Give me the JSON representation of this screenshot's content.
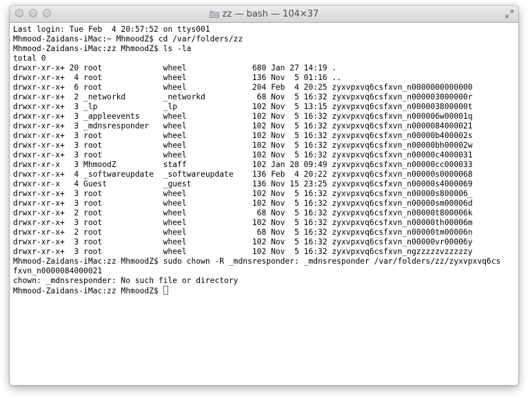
{
  "window": {
    "title": "zz — bash — 104×37",
    "folder_icon": "folder-icon",
    "controls": [
      "close-button",
      "minimize-button",
      "zoom-button"
    ],
    "resize_icon": "fullscreen-arrows-icon"
  },
  "terminal": {
    "lines": [
      "Last login: Tue Feb  4 20:57:52 on ttys001",
      "Mhmood-Zaidans-iMac:~ MhmoodZ$ cd /var/folders/zz",
      "Mhmood-Zaidans-iMac:zz MhmoodZ$ ls -la",
      "total 0",
      "drwxr-xr-x+ 20 root             wheel              680 Jan 27 14:19 .",
      "drwxr-xr-x+  4 root             wheel              136 Nov  5 01:16 ..",
      "drwxr-xr-x+  6 root             wheel              204 Feb  4 20:25 zyxvpxvq6csfxvn_n0000000000000",
      "drwxr-xr-x+  2 _networkd        _networkd           68 Nov  5 16:32 zyxvpxvq6csfxvn_n000003000000r",
      "drwxr-xr-x+  3 _lp              _lp                102 Nov  5 13:15 zyxvpxvq6csfxvn_n000003800000t",
      "drwxr-xr-x+  3 _appleevents     wheel              102 Nov  5 16:32 zyxvpxvq6csfxvn_n000006w00001q",
      "drwxr-xr-x+  3 _mdnsresponder   wheel              102 Nov  5 16:32 zyxvpxvq6csfxvn_n0000084000021",
      "drwxr-xr-x+  3 root             wheel              102 Nov  5 16:32 zyxvpxvq6csfxvn_n00000b400002s",
      "drwxr-xr-x+  3 root             wheel              102 Nov  5 16:32 zyxvpxvq6csfxvn_n00000bh00002w",
      "drwxr-xr-x+  3 root             wheel              102 Nov  5 16:32 zyxvpxvq6csfxvn_n00000c4000031",
      "drwxr-xr-x   3 MhmoodZ          staff              102 Jan 28 09:49 zyxvpxvq6csfxvn_n00000cc000033",
      "drwxr-xr-x+  4 _softwareupdate  _softwareupdate    136 Feb  4 20:22 zyxvpxvq6csfxvn_n00000s0000068",
      "drwxr-xr-x   4 Guest            _guest             136 Nov 15 23:25 zyxvpxvq6csfxvn_n00000s4000069",
      "drwxr-xr-x+  3 root             wheel              102 Nov  5 16:32 zyxvpxvq6csfxvn_n00000s800006_",
      "drwxr-xr-x+  3 root             wheel              102 Nov  5 16:32 zyxvpxvq6csfxvn_n00000sm00006d",
      "drwxr-xr-x+  2 root             wheel               68 Nov  5 16:32 zyxvpxvq6csfxvn_n00000t800006k",
      "drwxr-xr-x+  3 root             wheel              102 Nov  5 16:32 zyxvpxvq6csfxvn_n00000th00006m",
      "drwxr-xr-x+  2 root             wheel               68 Nov  5 16:32 zyxvpxvq6csfxvn_n00000tm00006n",
      "drwxr-xr-x+  3 root             wheel              102 Nov  5 16:32 zyxvpxvq6csfxvn_n00000vr00006y",
      "drwxr-xr-x+  3 root             wheel              102 Nov  5 16:32 zyxvpxvq6csfxvn_ngzzzzzvzzzzzy",
      "Mhmood-Zaidans-iMac:zz MhmoodZ$ sudo chown -R _mdnsresponder: _mdnsresponder /var/folders/zz/zyxvpxvq6cs",
      "fxvn_n0000084000021",
      "chown: _mdnsresponder: No such file or directory"
    ],
    "prompt": "Mhmood-Zaidans-iMac:zz MhmoodZ$ "
  }
}
